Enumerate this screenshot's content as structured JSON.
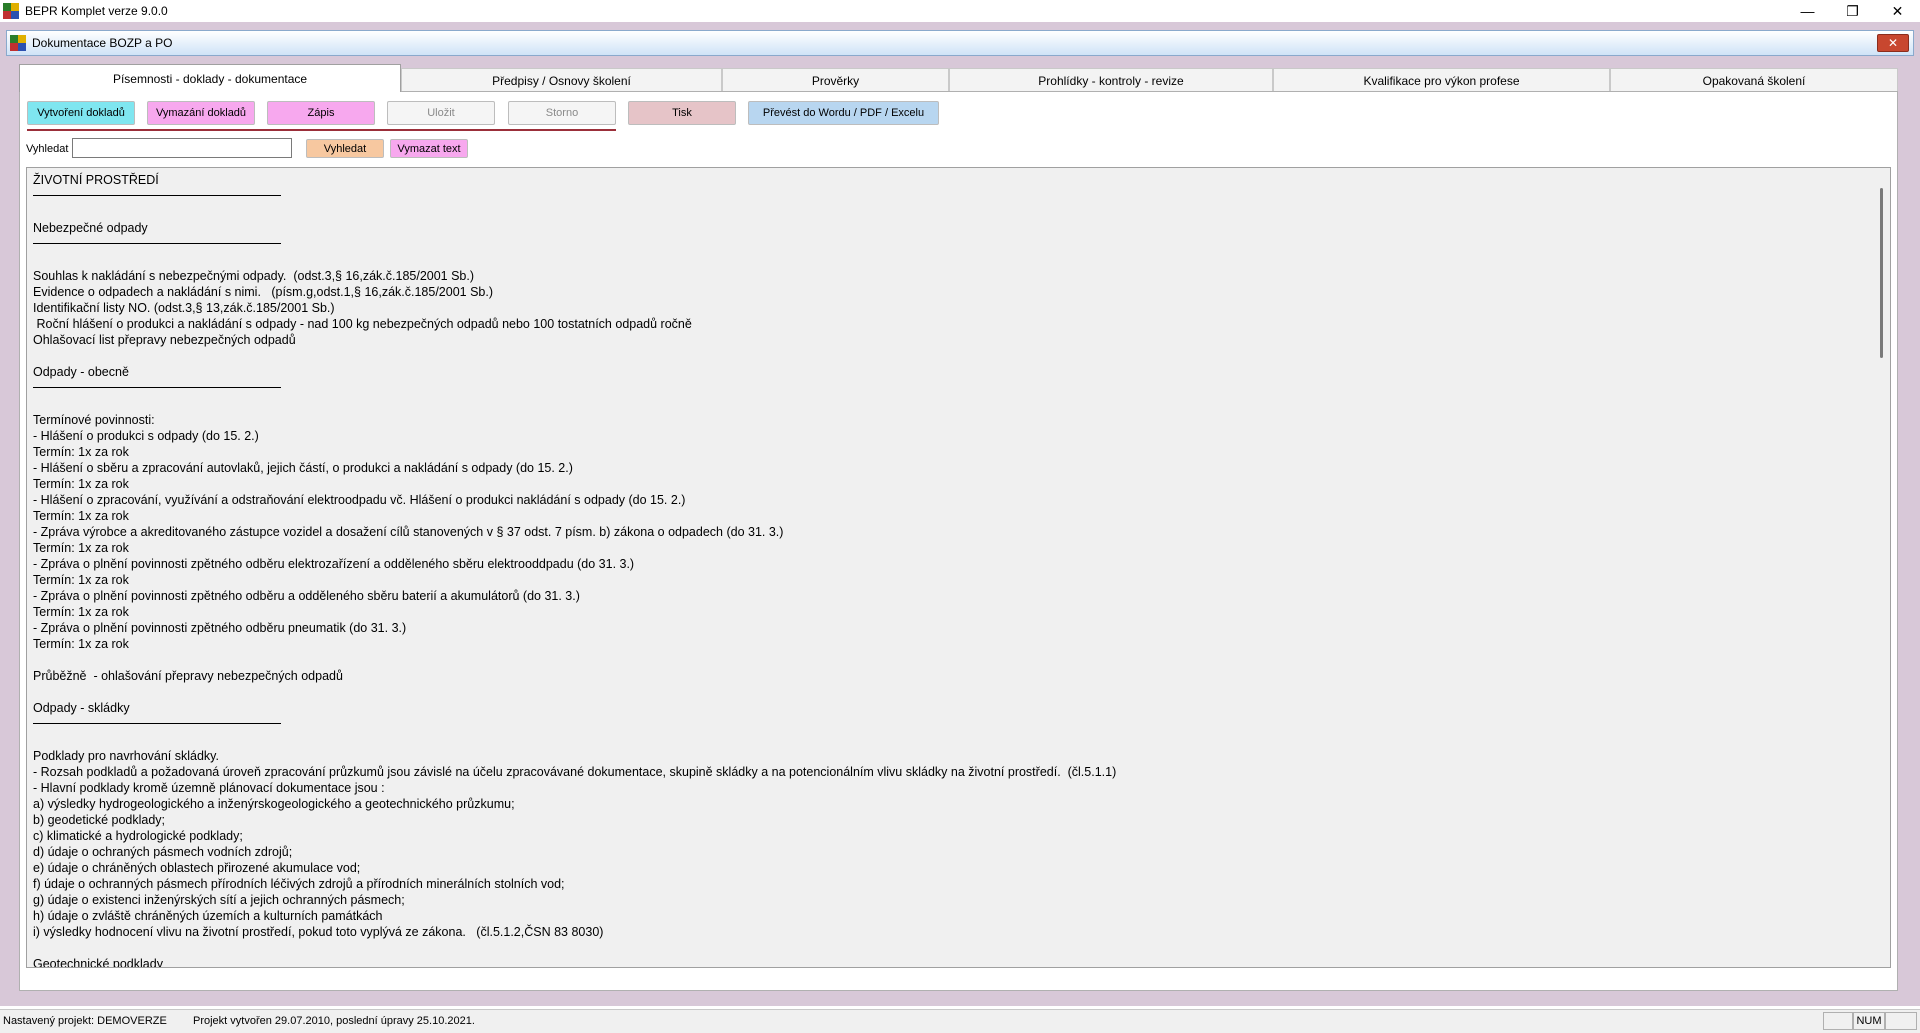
{
  "window": {
    "title": "BEPR Komplet verze 9.0.0",
    "child_title": "Dokumentace BOZP a PO",
    "controls": {
      "minimize": "—",
      "restore": "❐",
      "close": "✕"
    }
  },
  "tabs": [
    {
      "label": "Písemnosti - doklady - dokumentace"
    },
    {
      "label": "Předpisy / Osnovy školení"
    },
    {
      "label": "Prověrky"
    },
    {
      "label": "Prohlídky - kontroly - revize"
    },
    {
      "label": "Kvalifikace pro výkon profese"
    },
    {
      "label": "Opakovaná školení"
    }
  ],
  "toolbar": {
    "create": "Vytvoření dokladů",
    "delete": "Vymazání dokladů",
    "record": "Zápis",
    "save": "Uložit",
    "cancel": "Storno",
    "print": "Tisk",
    "export": "Převést do Wordu / PDF / Excelu"
  },
  "search": {
    "label": "Vyhledat",
    "value": "",
    "search_button": "Vyhledat",
    "clear_button": "Vymazat text"
  },
  "document": {
    "lines": [
      {
        "t": "ŽIVOTNÍ PROSTŘEDÍ"
      },
      {
        "rule": true
      },
      {
        "t": "Nebezpečné odpady"
      },
      {
        "rule": true
      },
      {
        "t": "Souhlas k nakládání s nebezpečnými odpady.  (odst.3,§ 16,zák.č.185/2001 Sb.)"
      },
      {
        "t": "Evidence o odpadech a nakládání s nimi.   (písm.g,odst.1,§ 16,zák.č.185/2001 Sb.)"
      },
      {
        "t": "Identifikační listy NO. (odst.3,§ 13,zák.č.185/2001 Sb.)"
      },
      {
        "t": " Roční hlášení o produkci a nakládání s odpady - nad 100 kg nebezpečných odpadů nebo 100 tostatních odpadů ročně"
      },
      {
        "t": "Ohlašovací list přepravy nebezpečných odpadů"
      },
      {
        "t": ""
      },
      {
        "t": "Odpady - obecně"
      },
      {
        "rule": true
      },
      {
        "t": "Termínové povinnosti:"
      },
      {
        "t": "- Hlášení o produkci s odpady (do 15. 2.)"
      },
      {
        "t": "Termín: 1x za rok"
      },
      {
        "t": "- Hlášení o sběru a zpracování autovlaků, jejich částí, o produkci a nakládání s odpady (do 15. 2.)"
      },
      {
        "t": "Termín: 1x za rok"
      },
      {
        "t": "- Hlášení o zpracování, využívání a odstraňování elektroodpadu vč. Hlášení o produkci nakládání s odpady (do 15. 2.)"
      },
      {
        "t": "Termín: 1x za rok"
      },
      {
        "t": "- Zpráva výrobce a akreditovaného zástupce vozidel a dosažení cílů stanovených v § 37 odst. 7 písm. b) zákona o odpadech (do 31. 3.)"
      },
      {
        "t": "Termín: 1x za rok"
      },
      {
        "t": "- Zpráva o plnění povinnosti zpětného odběru elektrozařízení a odděleného sběru elektrooddpadu (do 31. 3.)"
      },
      {
        "t": "Termín: 1x za rok"
      },
      {
        "t": "- Zpráva o plnění povinnosti zpětného odběru a odděleného sběru baterií a akumulátorů (do 31. 3.)"
      },
      {
        "t": "Termín: 1x za rok"
      },
      {
        "t": "- Zpráva o plnění povinnosti zpětného odběru pneumatik (do 31. 3.)"
      },
      {
        "t": "Termín: 1x za rok"
      },
      {
        "t": ""
      },
      {
        "t": "Průběžně  - ohlašování přepravy nebezpečných odpadů"
      },
      {
        "t": ""
      },
      {
        "t": "Odpady - skládky"
      },
      {
        "rule": true
      },
      {
        "t": "Podklady pro navrhování skládky."
      },
      {
        "t": "- Rozsah podkladů a požadovaná úroveň zpracování průzkumů jsou závislé na účelu zpracovávané dokumentace, skupině skládky a na potencionálním vlivu skládky na životní prostředí.  (čl.5.1.1)"
      },
      {
        "t": "- Hlavní podklady kromě územně plánovací dokumentace jsou :"
      },
      {
        "t": "a) výsledky hydrogeologického a inženýrskogeologického a geotechnického průzkumu;"
      },
      {
        "t": "b) geodetické podklady;"
      },
      {
        "t": "c) klimatické a hydrologické podklady;"
      },
      {
        "t": "d) údaje o ochraných pásmech vodních zdrojů;"
      },
      {
        "t": "e) údaje o chráněných oblastech přirozené akumulace vod;"
      },
      {
        "t": "f) údaje o ochranných pásmech přírodních léčivých zdrojů a přírodních minerálních stolních vod;"
      },
      {
        "t": "g) údaje o existenci inženýrských sítí a jejich ochranných pásmech;"
      },
      {
        "t": "h) údaje o zvláště chráněných územích a kulturních památkách"
      },
      {
        "t": "i) výsledky hodnocení vlivu na životní prostředí, pokud toto vyplývá ze zákona.   (čl.5.1.2,ČSN 83 8030)"
      },
      {
        "t": ""
      },
      {
        "t": "Geotechnické podklady"
      }
    ]
  },
  "statusbar": {
    "project": "Nastavený projekt: DEMOVERZE",
    "info": "Projekt vytvořen 29.07.2010, poslední úpravy 25.10.2021.",
    "num": "NUM"
  },
  "colors": {
    "create_btn": "#7fe6f0",
    "delete_btn": "#f7a8ee",
    "record_btn": "#f7a8ee",
    "print_btn": "#e6c4c8",
    "export_btn": "#b8d6f0",
    "search_btn": "#f7c8a0",
    "clear_btn": "#f7a8ee",
    "mdi_background": "#d8c8d8",
    "accent_line": "#9b2f3a"
  }
}
